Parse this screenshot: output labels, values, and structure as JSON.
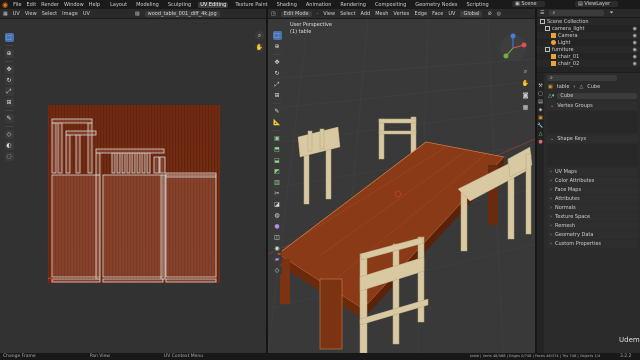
{
  "topbar": {
    "menus": [
      "File",
      "Edit",
      "Render",
      "Window",
      "Help"
    ],
    "workspaces": [
      "Layout",
      "Modeling",
      "Sculpting",
      "UV Editing",
      "Texture Paint",
      "Shading",
      "Animation",
      "Rendering",
      "Compositing",
      "Geometry Nodes",
      "Scripting"
    ],
    "active_workspace": "UV Editing",
    "scene": "Scene",
    "view_layer": "ViewLayer"
  },
  "uv_editor": {
    "header": [
      "UV",
      "View",
      "Select",
      "Image",
      "UV"
    ],
    "image_name": "wood_table_001_diff_4k.jpg"
  },
  "viewport": {
    "mode": "Edit Mode",
    "menus": [
      "View",
      "Select",
      "Add",
      "Mesh",
      "Vertex",
      "Edge",
      "Face",
      "UV"
    ],
    "transform": "Global",
    "overlay_title": "User Perspective",
    "overlay_object": "(1) table"
  },
  "outliner": {
    "rows": [
      {
        "label": "Scene Collection",
        "indent": 0,
        "icon": "collection-icon",
        "color": "#bbbbbb"
      },
      {
        "label": "camera_light",
        "indent": 1,
        "icon": "collection-icon",
        "color": "#bbbbbb"
      },
      {
        "label": "Camera",
        "indent": 2,
        "icon": "camera-icon",
        "color": "#e8a33a"
      },
      {
        "label": "Light",
        "indent": 2,
        "icon": "light-icon",
        "color": "#e8a33a"
      },
      {
        "label": "furniture",
        "indent": 1,
        "icon": "collection-icon",
        "color": "#bbbbbb"
      },
      {
        "label": "chair_01",
        "indent": 2,
        "icon": "mesh-icon",
        "color": "#e8a33a"
      },
      {
        "label": "chair_02",
        "indent": 2,
        "icon": "mesh-icon",
        "color": "#e8a33a"
      }
    ]
  },
  "properties": {
    "breadcrumb_object": "table",
    "breadcrumb_mesh": "Cube",
    "mesh_name": "Cube",
    "panels": [
      "Vertex Groups",
      "Shape Keys",
      "UV Maps",
      "Color Attributes",
      "Face Maps",
      "Attributes",
      "Normals",
      "Texture Space",
      "Remesh",
      "Geometry Data",
      "Custom Properties"
    ]
  },
  "statusbar": {
    "left": [
      "Change Frame",
      "Pan View",
      "UV Context Menu"
    ],
    "stats": "table | Verts 48/368 | Edges 0/748 | Faces 46/374 | Tris 748 | Objects 1/4",
    "version": "3.2.2"
  },
  "watermark": "Udemy",
  "colors": {
    "accent": "#4772b3",
    "wood": "#8a3a16",
    "chair": "#d9c9a3",
    "active_tab": "#3d3d3d"
  }
}
